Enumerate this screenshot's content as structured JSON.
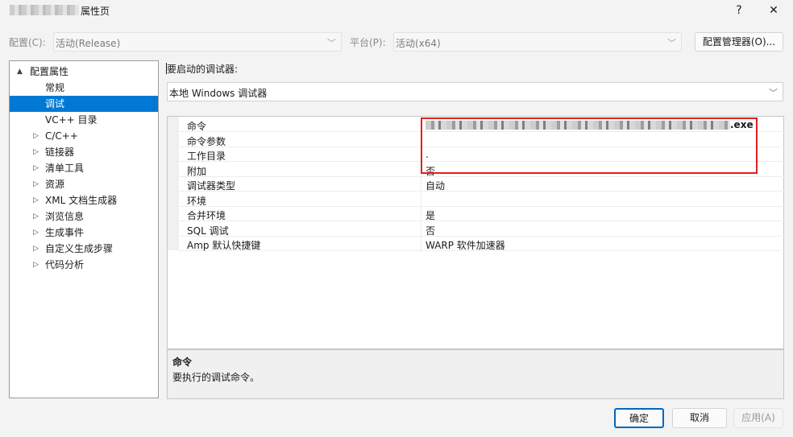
{
  "window": {
    "title": "属性页",
    "help_label": "?",
    "close_label": "✕"
  },
  "config_bar": {
    "config_label": "配置(C):",
    "config_value": "活动(Release)",
    "platform_label": "平台(P):",
    "platform_value": "活动(x64)",
    "manager_button": "配置管理器(O)..."
  },
  "tree": {
    "root": "配置属性",
    "items": [
      {
        "label": "常规",
        "expandable": false,
        "selected": false
      },
      {
        "label": "调试",
        "expandable": false,
        "selected": true
      },
      {
        "label": "VC++ 目录",
        "expandable": false,
        "selected": false
      },
      {
        "label": "C/C++",
        "expandable": true,
        "selected": false
      },
      {
        "label": "链接器",
        "expandable": true,
        "selected": false
      },
      {
        "label": "清单工具",
        "expandable": true,
        "selected": false
      },
      {
        "label": "资源",
        "expandable": true,
        "selected": false
      },
      {
        "label": "XML 文档生成器",
        "expandable": true,
        "selected": false
      },
      {
        "label": "浏览信息",
        "expandable": true,
        "selected": false
      },
      {
        "label": "生成事件",
        "expandable": true,
        "selected": false
      },
      {
        "label": "自定义生成步骤",
        "expandable": true,
        "selected": false
      },
      {
        "label": "代码分析",
        "expandable": true,
        "selected": false
      }
    ]
  },
  "debugger": {
    "heading": "要启动的调试器:",
    "selected": "本地 Windows 调试器"
  },
  "properties": [
    {
      "name": "命令",
      "value": ".exe"
    },
    {
      "name": "命令参数",
      "value": ""
    },
    {
      "name": "工作目录",
      "value": "."
    },
    {
      "name": "附加",
      "value": "否"
    },
    {
      "name": "调试器类型",
      "value": "自动"
    },
    {
      "name": "环境",
      "value": ""
    },
    {
      "name": "合并环境",
      "value": "是"
    },
    {
      "name": "SQL 调试",
      "value": "否"
    },
    {
      "name": "Amp 默认快捷键",
      "value": "WARP 软件加速器"
    }
  ],
  "description": {
    "title": "命令",
    "text": "要执行的调试命令。"
  },
  "buttons": {
    "ok": "确定",
    "cancel": "取消",
    "apply": "应用(A)"
  },
  "icons": {
    "expanded": "▲",
    "collapsed": "▷",
    "dropdown": "chevron-down-icon"
  },
  "colors": {
    "selection": "#0078d4",
    "highlight_box": "#e02020",
    "default_button_border": "#0067c0"
  }
}
